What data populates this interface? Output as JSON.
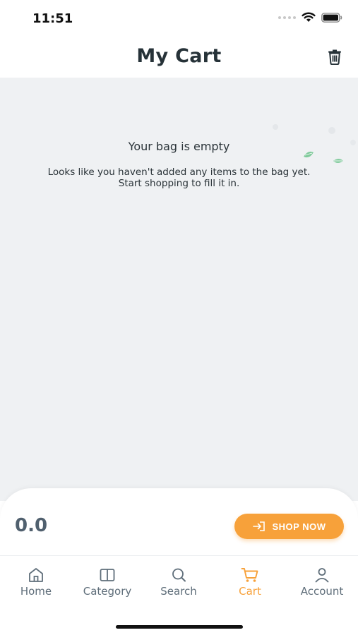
{
  "status_bar": {
    "time": "11:51"
  },
  "header": {
    "title": "My Cart",
    "trash_icon": "trash-icon"
  },
  "empty_state": {
    "title": "Your bag is empty",
    "message_line1": "Looks like you haven't added any items to the bag yet.",
    "message_line2": "Start shopping to fill it in."
  },
  "footer": {
    "total": "0.0",
    "shop_now_label": "SHOP NOW",
    "shop_now_icon": "login-arrow-icon"
  },
  "tabs": [
    {
      "label": "Home",
      "icon": "home-icon",
      "active": false
    },
    {
      "label": "Category",
      "icon": "book-icon",
      "active": false
    },
    {
      "label": "Search",
      "icon": "search-icon",
      "active": false
    },
    {
      "label": "Cart",
      "icon": "cart-icon",
      "active": true
    },
    {
      "label": "Account",
      "icon": "user-icon",
      "active": false
    }
  ],
  "colors": {
    "accent": "#f7a13a",
    "background": "#eff1f3",
    "title": "#263238",
    "tab_inactive": "#5f6e7a",
    "leaf": "#6cc38b"
  }
}
